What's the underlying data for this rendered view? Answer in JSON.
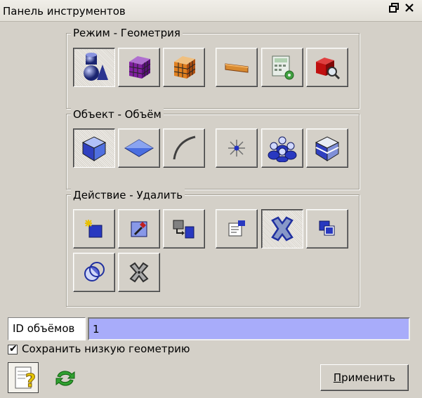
{
  "window": {
    "title": "Панель инструментов",
    "float_icon": "float-icon",
    "close_icon": "close-icon"
  },
  "groups": {
    "mode": {
      "label": "Режим - Геометрия"
    },
    "object": {
      "label": "Объект - Объём"
    },
    "action": {
      "label": "Действие - Удалить"
    }
  },
  "mode_buttons": [
    {
      "icon": "geometry-shapes-icon",
      "selected": true
    },
    {
      "icon": "mesh-cube-purple-icon",
      "selected": false
    },
    {
      "icon": "mesh-cube-orange-icon",
      "selected": false
    },
    {
      "icon": "boundary-strip-icon",
      "selected": false
    },
    {
      "icon": "calculator-settings-icon",
      "selected": false
    },
    {
      "icon": "inspect-cube-icon",
      "selected": false
    }
  ],
  "object_buttons": [
    {
      "icon": "volume-cube-icon",
      "selected": true
    },
    {
      "icon": "surface-icon",
      "selected": false
    },
    {
      "icon": "curve-icon",
      "selected": false
    },
    {
      "icon": "vertex-icon",
      "selected": false
    },
    {
      "icon": "group-icon",
      "selected": false
    },
    {
      "icon": "body-icon",
      "selected": false
    }
  ],
  "action_buttons": [
    {
      "icon": "create-icon",
      "selected": false
    },
    {
      "icon": "modify-icon",
      "selected": false
    },
    {
      "icon": "transform-icon",
      "selected": false
    },
    {
      "icon": "properties-icon",
      "selected": false
    },
    {
      "icon": "delete-icon",
      "selected": true
    },
    {
      "icon": "copy-icon",
      "selected": false
    },
    {
      "icon": "boolean-icon",
      "selected": false
    },
    {
      "icon": "cut-icon",
      "selected": false
    }
  ],
  "id_field": {
    "label": "ID объёмов",
    "value": "1"
  },
  "keep_geometry": {
    "label": "Сохранить низкую геометрию",
    "checked": true
  },
  "bottom": {
    "help_icon": "help-icon",
    "refresh_icon": "refresh-icon",
    "apply_label_underlined": "П",
    "apply_label_rest": "рименить"
  },
  "colors": {
    "accent_input": "#a8acfa",
    "panel_bg": "#d4d0c8"
  }
}
